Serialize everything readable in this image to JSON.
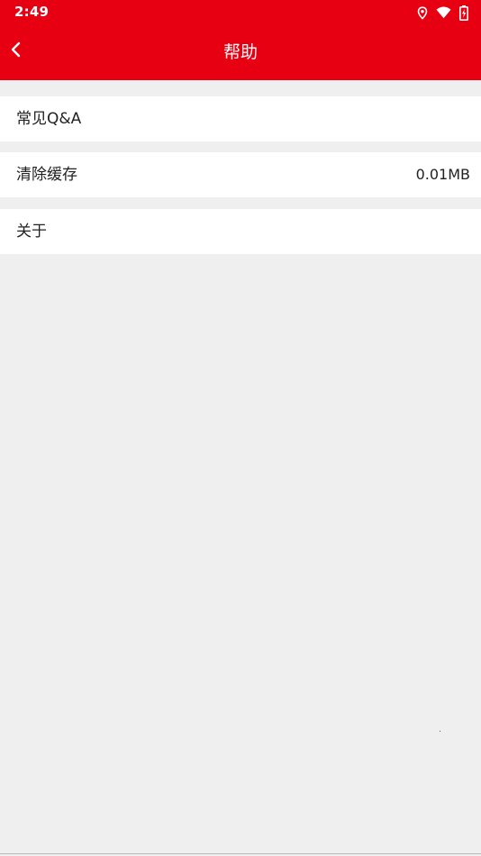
{
  "status_bar": {
    "time": "2:49",
    "icons": [
      "location-icon",
      "wifi-icon",
      "battery-charging-icon"
    ]
  },
  "header": {
    "title": "帮助",
    "back_icon": "chevron-left-icon"
  },
  "menu": {
    "items": [
      {
        "label": "常见Q&A",
        "value": ""
      },
      {
        "label": "清除缓存",
        "value": "0.01MB"
      },
      {
        "label": "关于",
        "value": ""
      }
    ]
  },
  "colors": {
    "brand_red": "#e60012",
    "background": "#efefef",
    "row_background": "#ffffff",
    "text": "#222222"
  }
}
